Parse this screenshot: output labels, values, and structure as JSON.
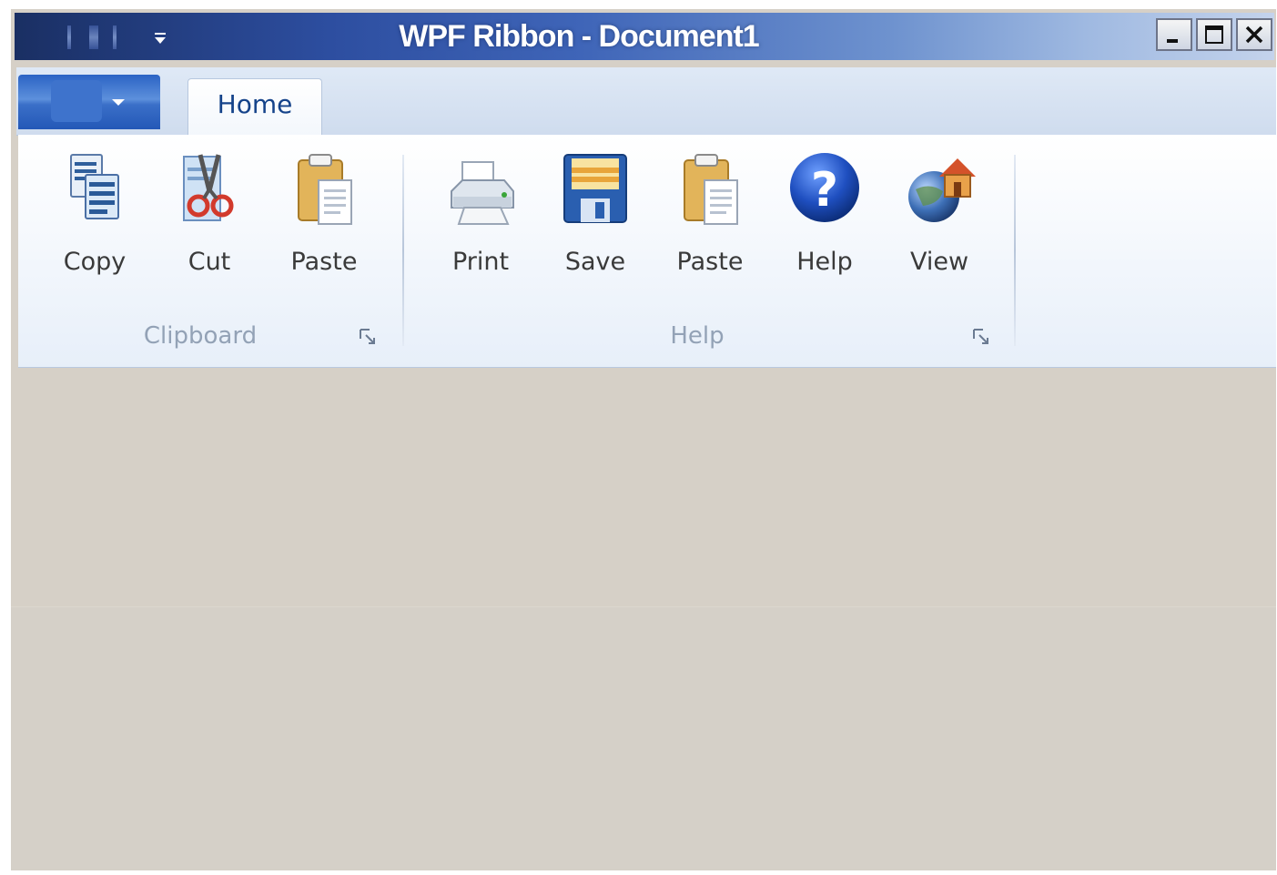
{
  "window": {
    "title": "WPF Ribbon - Document1",
    "controls": {
      "minimize": "_",
      "maximize": "□",
      "close": "✕"
    }
  },
  "quick_access": {
    "dropdown_icon": "dropdown-arrow-icon"
  },
  "app_menu": {
    "icon": "app-menu-icon"
  },
  "tabs": [
    {
      "label": "Home",
      "selected": true
    }
  ],
  "ribbon": {
    "groups": [
      {
        "label": "Clipboard",
        "buttons": [
          {
            "label": "Copy",
            "icon": "copy-icon"
          },
          {
            "label": "Cut",
            "icon": "scissors-icon"
          },
          {
            "label": "Paste",
            "icon": "clipboard-icon"
          }
        ]
      },
      {
        "label": "Help",
        "buttons": [
          {
            "label": "Print",
            "icon": "printer-icon"
          },
          {
            "label": "Save",
            "icon": "floppy-disk-icon"
          },
          {
            "label": "Paste",
            "icon": "clipboard-icon"
          },
          {
            "label": "Help",
            "icon": "help-question-icon"
          },
          {
            "label": "View",
            "icon": "globe-house-icon"
          }
        ]
      }
    ]
  },
  "colors": {
    "title_bar": "#2d4ea0",
    "tab_text": "#15438a",
    "content_bg": "#d6d0c7",
    "group_label": "#93a2b6"
  }
}
